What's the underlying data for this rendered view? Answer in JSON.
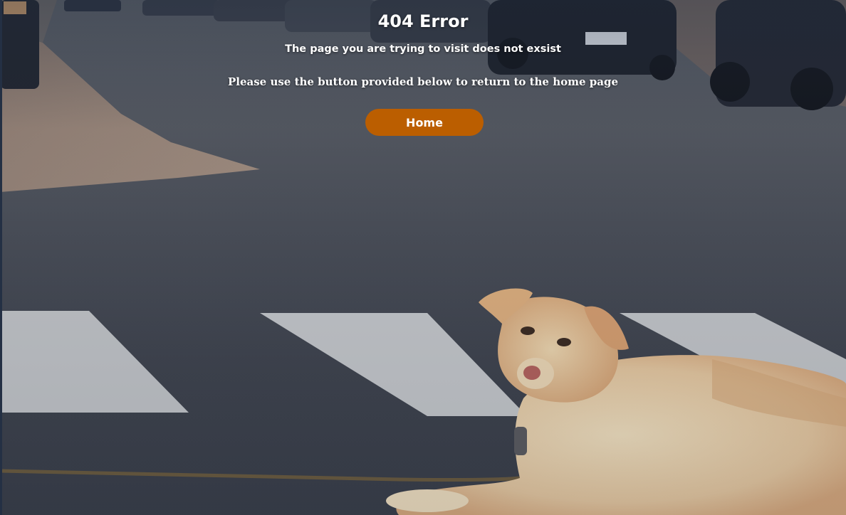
{
  "error": {
    "title": "404 Error",
    "subtitle": "The page you are trying to visit does not exsist",
    "instructions": "Please use the button provided below to return to the home page"
  },
  "actions": {
    "home_label": "Home"
  },
  "colors": {
    "button_bg": "#bb5e00",
    "text": "#ffffff"
  }
}
